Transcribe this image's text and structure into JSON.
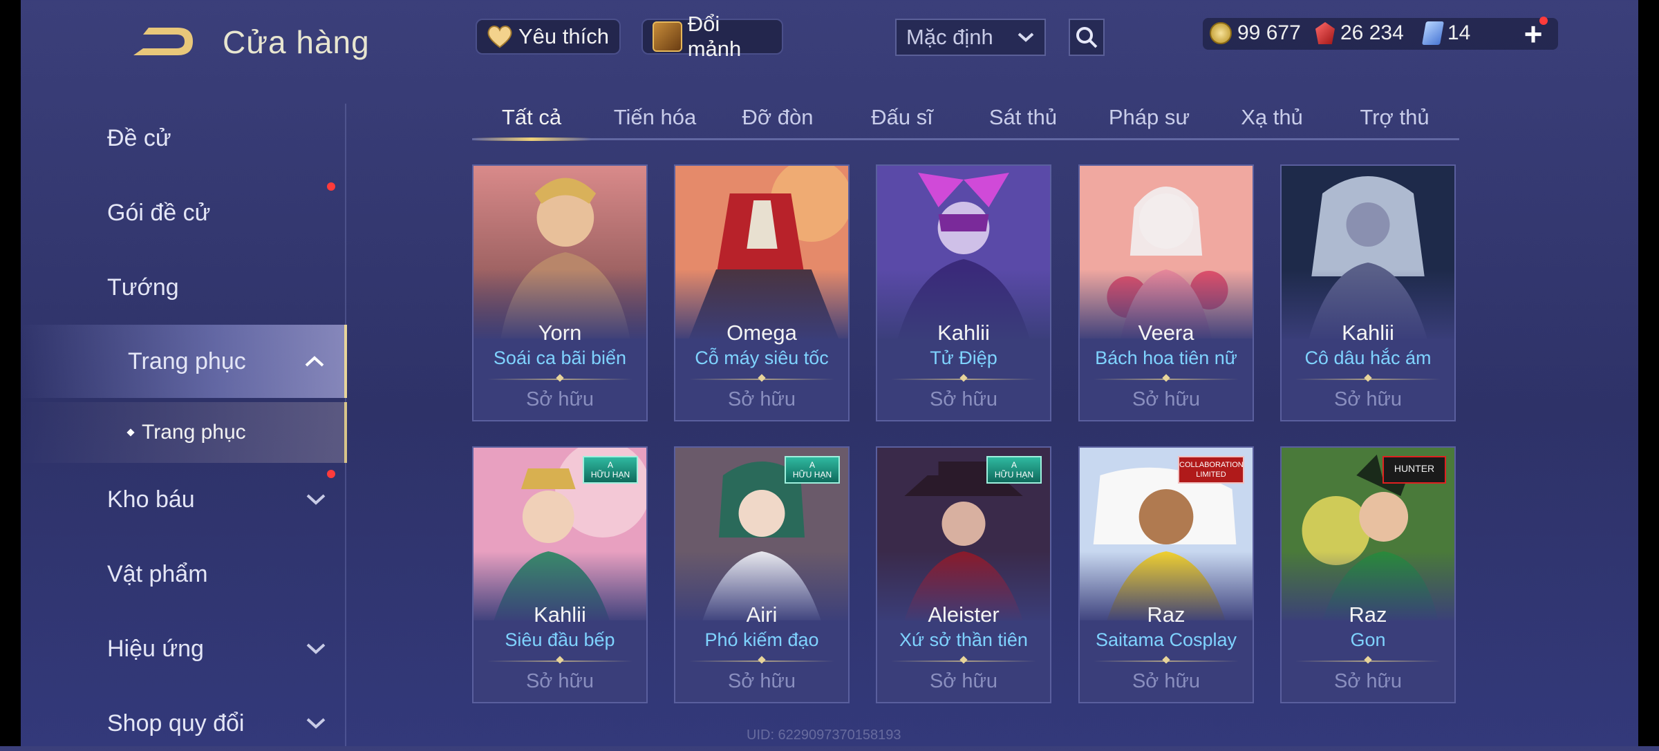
{
  "header": {
    "title": "Cửa hàng",
    "favorites_label": "Yêu thích",
    "shard_exchange_label": "Đổi mảnh",
    "sort_selected": "Mặc định",
    "currencies": {
      "gold": "99 677",
      "ruby": "26 234",
      "voucher": "14"
    }
  },
  "sidebar": {
    "items": [
      {
        "label": "Đề cử"
      },
      {
        "label": "Gói đề cử"
      },
      {
        "label": "Tướng"
      },
      {
        "label": "Trang phục"
      },
      {
        "label": "Kho báu"
      },
      {
        "label": "Vật phẩm"
      },
      {
        "label": "Hiệu ứng"
      },
      {
        "label": "Shop quy đổi"
      }
    ],
    "sub_item": "Trang phục"
  },
  "tabs": [
    "Tất cả",
    "Tiến hóa",
    "Đỡ đòn",
    "Đấu sĩ",
    "Sát thủ",
    "Pháp sư",
    "Xạ thủ",
    "Trợ thủ"
  ],
  "cards": [
    {
      "hero": "Yorn",
      "skin": "Soái ca bãi biển",
      "status": "Sở hữu"
    },
    {
      "hero": "Omega",
      "skin": "Cỗ máy siêu tốc",
      "status": "Sở hữu"
    },
    {
      "hero": "Kahlii",
      "skin": "Tử Điệp",
      "status": "Sở hữu"
    },
    {
      "hero": "Veera",
      "skin": "Bách hoa tiên nữ",
      "status": "Sở hữu"
    },
    {
      "hero": "Kahlii",
      "skin": "Cô dâu hắc ám",
      "status": "Sở hữu"
    },
    {
      "hero": "Kahlii",
      "skin": "Siêu đầu bếp",
      "status": "Sở hữu",
      "badge": "A HỮU HẠN"
    },
    {
      "hero": "Airi",
      "skin": "Phó kiếm đạo",
      "status": "Sở hữu",
      "badge": "A HỮU HẠN"
    },
    {
      "hero": "Aleister",
      "skin": "Xứ sở thần tiên",
      "status": "Sở hữu",
      "badge": "A HỮU HẠN"
    },
    {
      "hero": "Raz",
      "skin": "Saitama Cosplay",
      "status": "Sở hữu",
      "badge": "COLLABORATION LIMITED"
    },
    {
      "hero": "Raz",
      "skin": "Gon",
      "status": "Sở hữu",
      "badge": "HUNTER"
    }
  ],
  "uid_text": "UID: 6229097370158193",
  "colors": {
    "accent_gold": "#e8d59a",
    "skin_name": "#7fd3ff",
    "notify_dot": "#ff3b3b"
  }
}
